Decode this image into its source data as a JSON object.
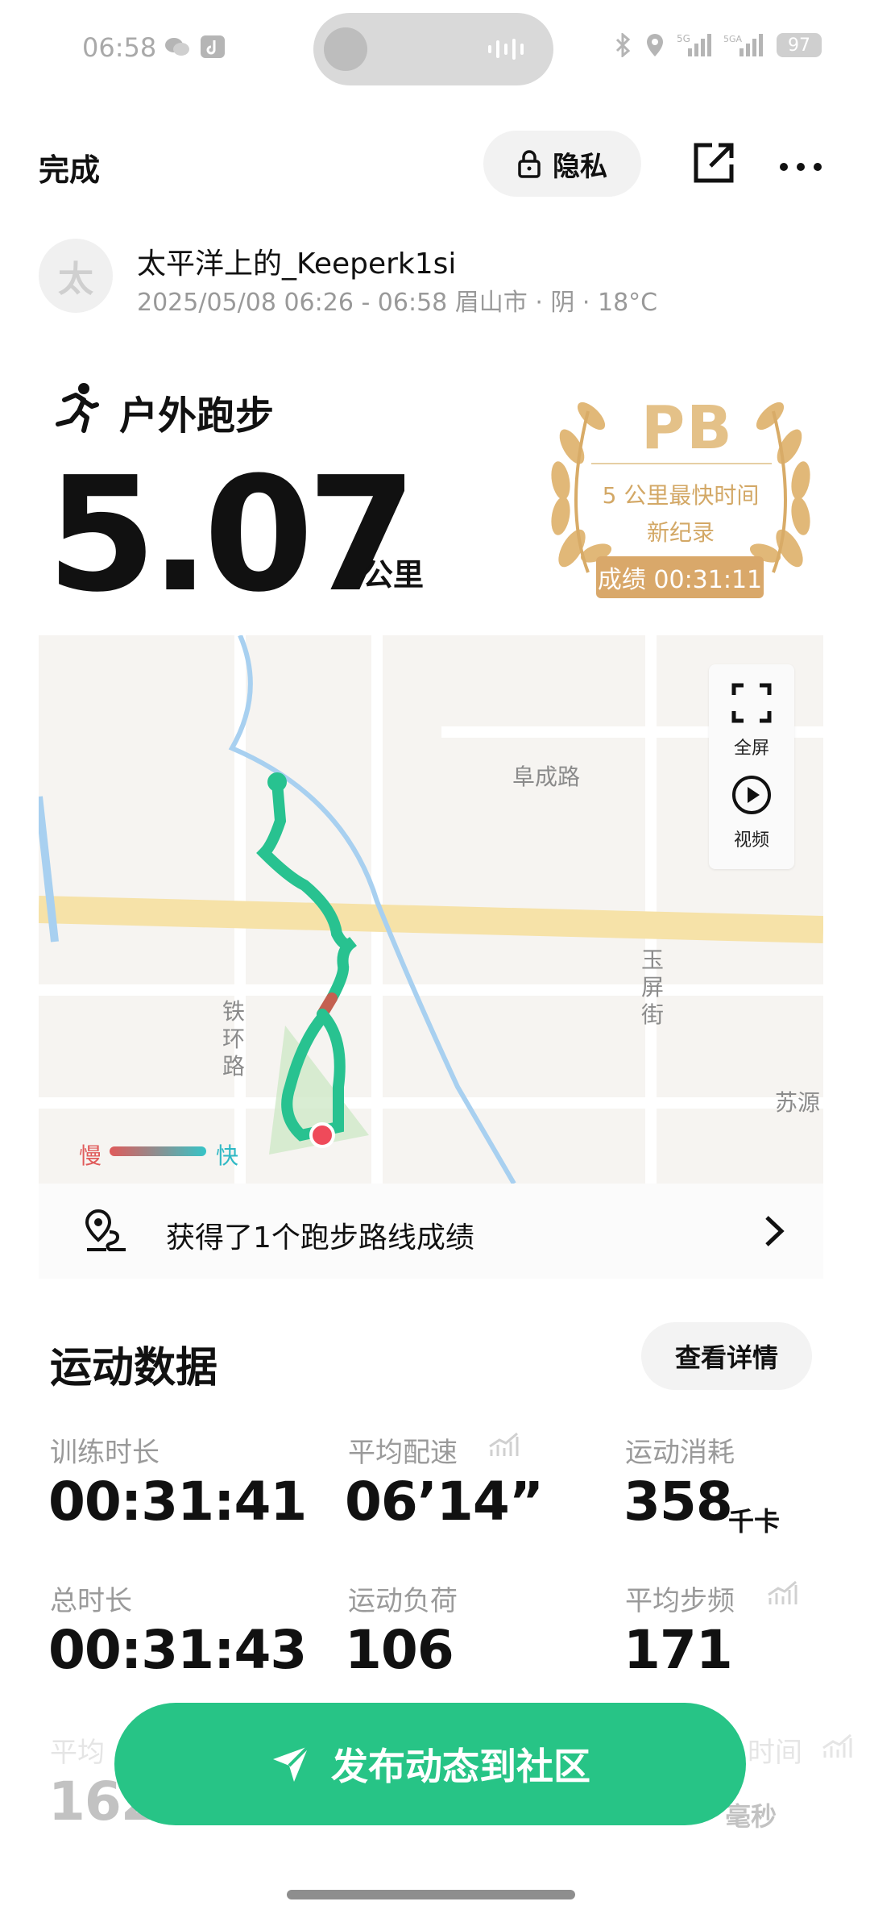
{
  "status_bar": {
    "time": "06:58",
    "battery": "97"
  },
  "header": {
    "done_label": "完成",
    "privacy_label": "隐私"
  },
  "user": {
    "avatar_char": "太",
    "name": "太平洋上的_Keeperk1si",
    "meta": "2025/05/08 06:26 - 06:58 眉山市 · 阴 · 18°C"
  },
  "activity": {
    "type": "户外跑步",
    "distance": "5.07",
    "distance_unit": "公里"
  },
  "pb": {
    "title": "PB",
    "desc_line1": "5 公里最快时间",
    "desc_line2": "新纪录",
    "score": "成绩 00:31:11",
    "colors": {
      "gold": "#e4c188",
      "dark_gold": "#d9a86a"
    }
  },
  "map": {
    "labels": {
      "road1": "阜成路",
      "road2": "玉屏街",
      "road3": "铁环路",
      "road4": "苏源"
    },
    "fullscreen_label": "全屏",
    "video_label": "视频",
    "legend_slow": "慢",
    "legend_fast": "快",
    "colors": {
      "route_fast": "#28c290",
      "route_slow": "#d9534f"
    }
  },
  "route_row": {
    "text": "获得了1个跑步路线成绩"
  },
  "stats": {
    "title": "运动数据",
    "detail_label": "查看详情",
    "items": [
      {
        "label": "训练时长",
        "value": "00:31:41",
        "unit": ""
      },
      {
        "label": "平均配速",
        "value": "06’14”",
        "unit": ""
      },
      {
        "label": "运动消耗",
        "value": "358",
        "unit": "千卡"
      },
      {
        "label": "总时长",
        "value": "00:31:43",
        "unit": ""
      },
      {
        "label": "运动负荷",
        "value": "106",
        "unit": ""
      },
      {
        "label": "平均步频",
        "value": "171",
        "unit": ""
      },
      {
        "label": "平均",
        "value": "162",
        "unit": ""
      },
      {
        "label": "时间",
        "value": "",
        "unit": "毫秒"
      }
    ]
  },
  "publish": {
    "label": "发布动态到社区",
    "color": "#27c486"
  }
}
